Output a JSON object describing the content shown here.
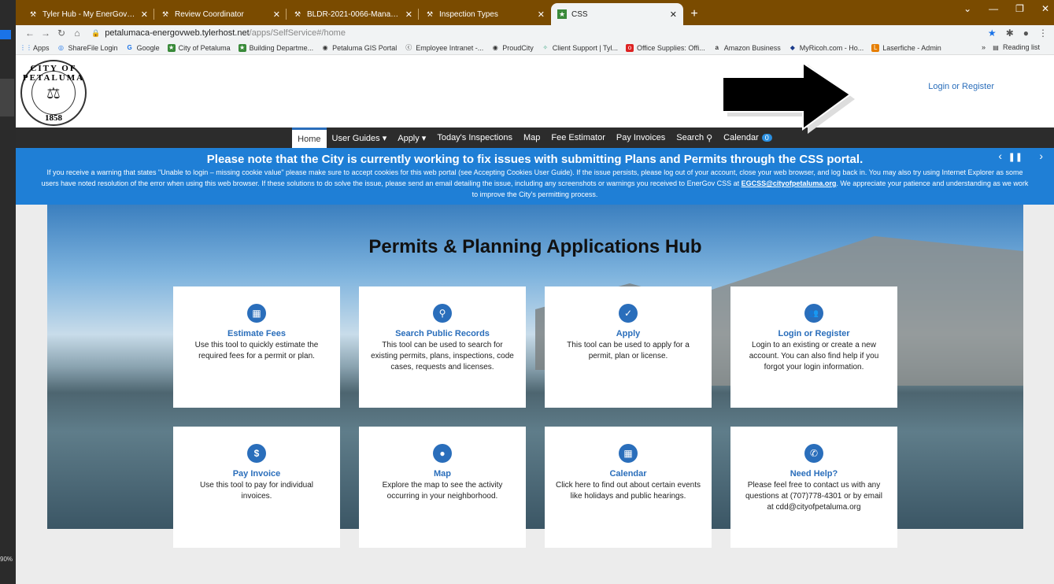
{
  "browser": {
    "tabs": [
      {
        "label": "Tyler Hub - My EnerGov Home",
        "icon": "hammer-icon"
      },
      {
        "label": "Review Coordinator",
        "icon": "hammer-icon"
      },
      {
        "label": "BLDR-2021-0066-Manage Permit",
        "icon": "hammer-icon"
      },
      {
        "label": "Inspection Types",
        "icon": "hammer-icon"
      },
      {
        "label": "CSS",
        "icon": "star-icon"
      }
    ],
    "url_host": "petalumaca-energovweb.tylerhost.net",
    "url_path": "/apps/SelfService#/home",
    "bookmarks": [
      "Apps",
      "ShareFile Login",
      "Google",
      "City of Petaluma",
      "Building Departme...",
      "Petaluma GIS Portal",
      "Employee Intranet -...",
      "ProudCity",
      "Client Support | Tyl...",
      "Office Supplies: Offi...",
      "Amazon Business",
      "MyRicoh.com - Ho...",
      "Laserfiche - Admin"
    ],
    "reading_list": "Reading list",
    "zoom": "90%"
  },
  "header": {
    "seal_top": "CITY OF PETALUMA",
    "seal_year": "1858",
    "login_link": "Login or Register"
  },
  "nav": {
    "items": [
      "Home",
      "User Guides ▾",
      "Apply ▾",
      "Today's Inspections",
      "Map",
      "Fee Estimator",
      "Pay Invoices",
      "Search"
    ],
    "calendar": "Calendar",
    "calendar_badge": "0"
  },
  "notice": {
    "title": "Please note that the City is currently working to fix issues with submitting Plans and Permits through the CSS portal.",
    "body_1": "If you receive a warning that states \"Unable to login – missing cookie value\" please make sure to accept cookies for this web portal (see Accepting Cookies User Guide). If the issue persists, please log out of your account, close your web browser, and log back in. You may also try using Internet Explorer as some users have noted resolution of the error when using this web browser. If these solutions to do solve the issue, please send an email detailing the issue, including any screenshots or warnings you received to EnerGov CSS at ",
    "email": "EGCSS@cityofpetaluma.org",
    "body_2": ". We appreciate your patience and understanding as we work to improve the City's permitting process."
  },
  "hero": {
    "title": "Permits & Planning Applications Hub"
  },
  "cards": [
    {
      "title": "Estimate Fees",
      "desc": "Use this tool to quickly estimate the required fees for a permit or plan.",
      "icon": "calculator-icon",
      "glyph": "▦"
    },
    {
      "title": "Search Public Records",
      "desc": "This tool can be used to search for existing permits, plans, inspections, code cases, requests and licenses.",
      "icon": "search-icon",
      "glyph": "⚲"
    },
    {
      "title": "Apply",
      "desc": "This tool can be used to apply for a permit, plan or license.",
      "icon": "clipboard-check-icon",
      "glyph": "✓"
    },
    {
      "title": "Login or Register",
      "desc": "Login to an existing or create a new account. You can also find help if you forgot your login information.",
      "icon": "users-icon",
      "glyph": "👥"
    },
    {
      "title": "Pay Invoice",
      "desc": "Use this tool to pay for individual invoices.",
      "icon": "dollar-icon",
      "glyph": "$"
    },
    {
      "title": "Map",
      "desc": "Explore the map to see the activity occurring in your neighborhood.",
      "icon": "map-marker-icon",
      "glyph": "●"
    },
    {
      "title": "Calendar",
      "desc": "Click here to find out about certain events like holidays and public hearings.",
      "icon": "calendar-icon",
      "glyph": "▦"
    },
    {
      "title": "Need Help?",
      "desc": "Please feel free to contact us with any questions at (707)778-4301 or by email at cdd@cityofpetaluma.org",
      "icon": "phone-icon",
      "glyph": "✆"
    }
  ],
  "colors": {
    "tabstrip": "#7a4b00",
    "nav_bg": "#2c2c2c",
    "notice_bg": "#1f7fd6",
    "accent": "#2a6ebb"
  }
}
